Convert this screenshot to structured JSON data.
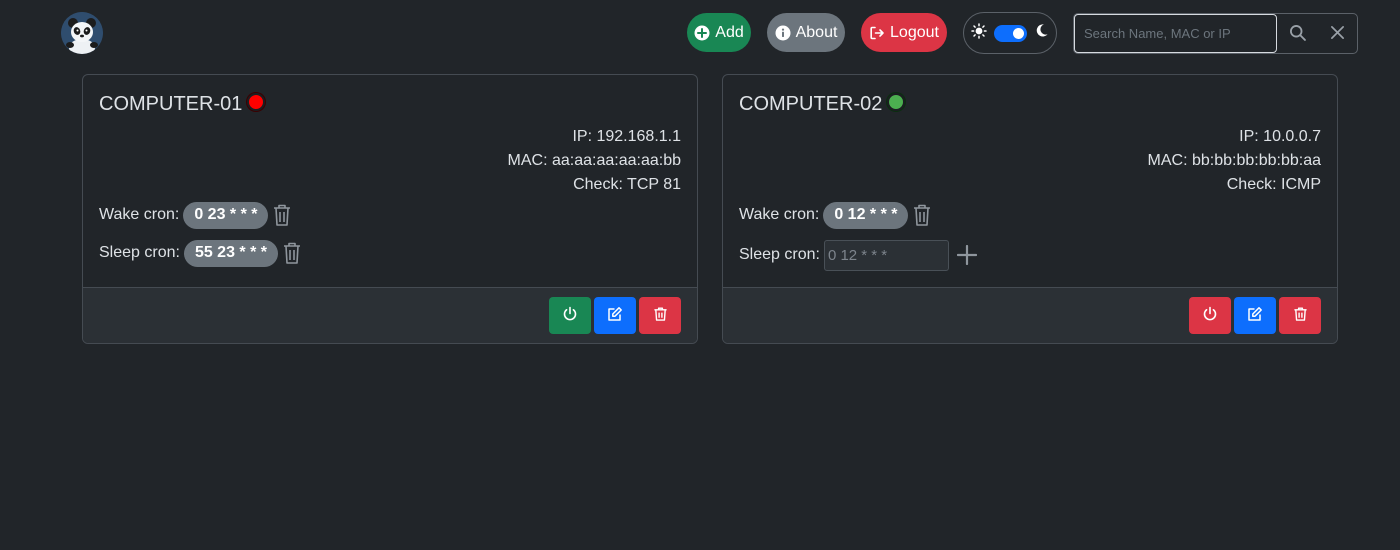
{
  "navbar": {
    "logo_icon": "panda-logo-icon",
    "add_label": "Add",
    "about_label": "About",
    "logout_label": "Logout",
    "search_placeholder": "Search Name, MAC or IP",
    "theme_switch_on": true
  },
  "colors": {
    "background": "#212529",
    "success": "#198754",
    "danger": "#dc3545",
    "secondary": "#6c757d",
    "primary": "#0d6efd",
    "status_offline": "#ff0000",
    "status_online": "#4caf50"
  },
  "hosts": [
    {
      "name": "COMPUTER-01",
      "status": "offline",
      "ip": "IP: 192.168.1.1",
      "mac": "MAC: aa:aa:aa:aa:aa:bb",
      "check": "Check: TCP 81",
      "wake_label": "Wake cron:",
      "wake_cron": "0 23 * * *",
      "sleep_label": "Sleep cron:",
      "sleep_cron": "55 23 * * *"
    },
    {
      "name": "COMPUTER-02",
      "status": "online",
      "ip": "IP: 10.0.0.7",
      "mac": "MAC: bb:bb:bb:bb:bb:aa",
      "check": "Check: ICMP",
      "wake_label": "Wake cron:",
      "wake_cron": "0 12 * * *",
      "sleep_label": "Sleep cron:",
      "sleep_placeholder": "0 12 * * *"
    }
  ]
}
